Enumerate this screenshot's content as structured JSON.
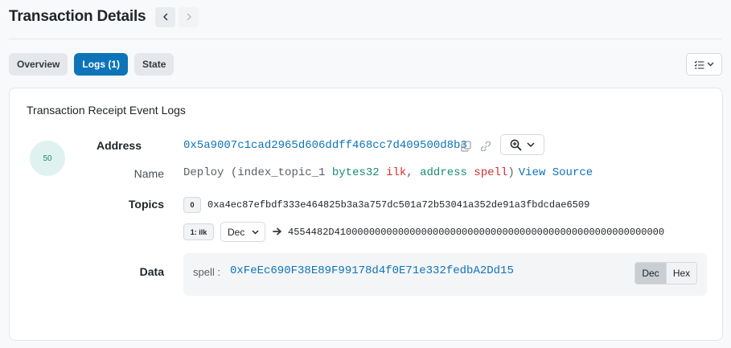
{
  "header": {
    "title": "Transaction Details"
  },
  "tabs": [
    {
      "label": "Overview",
      "active": false
    },
    {
      "label": "Logs (1)",
      "active": true
    },
    {
      "label": "State",
      "active": false
    }
  ],
  "icons": {
    "prev": "chevron-left-icon",
    "next": "chevron-right-icon",
    "view_toggle": "list-check-icon",
    "copy": "copy-icon",
    "link": "link-icon",
    "zoom": "zoom-in-icon",
    "arrow": "arrow-right-icon"
  },
  "colors": {
    "accent": "#0d74b8",
    "type": "#1a8b6f",
    "param_name": "#d32f2f",
    "badge_bg": "#e0f2ef"
  },
  "card": {
    "title": "Transaction Receipt Event Logs",
    "log": {
      "index": "50",
      "labels": {
        "address": "Address",
        "name": "Name",
        "topics": "Topics",
        "data": "Data"
      },
      "address": "0x5a9007c1cad2965d606ddff468cc7d409500d8b3",
      "signature": {
        "event": "Deploy",
        "open": " (",
        "param1_name": "index_topic_1",
        "param1_type": "bytes32",
        "param1_arg": "ilk",
        "sep": ", ",
        "param2_type": "address",
        "param2_arg": "spell",
        "close": ")",
        "view_source": "View Source"
      },
      "topics": [
        {
          "index": "0",
          "value": "0xa4ec87efbdf333e464825b3a3a757dc501a72b53041a352de91a3fbdcdae6509"
        },
        {
          "index": "1: ilk",
          "format": "Dec",
          "value": "4554482D410000000000000000000000000000000000000000000000000000000"
        }
      ],
      "data": {
        "param": "spell :",
        "value": "0xFeEc690F38E89F99178d4f0E71e332fedbA2Dd15",
        "toggle": {
          "dec": "Dec",
          "hex": "Hex",
          "selected": "Dec"
        }
      }
    }
  }
}
